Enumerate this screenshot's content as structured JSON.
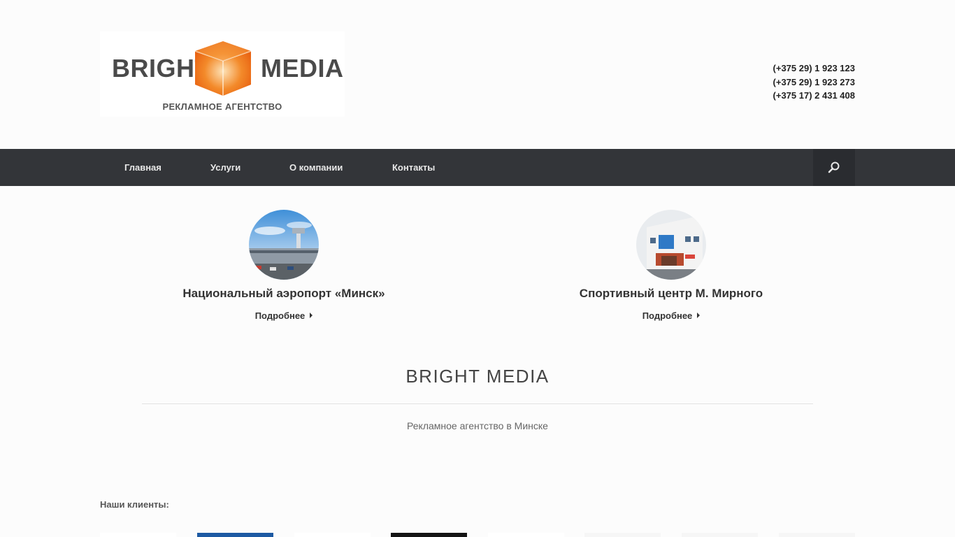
{
  "header": {
    "logo": {
      "word_left": "BRIGHT",
      "word_right": "MEDIA",
      "tagline": "РЕКЛАМНОЕ АГЕНТСТВО",
      "cube_color": "#f07a1e"
    },
    "phones": [
      "(+375 29) 1 923 123",
      "(+375 29) 1 923 273",
      "(+375 17) 2 431 408"
    ]
  },
  "nav": {
    "items": [
      {
        "label": "Главная"
      },
      {
        "label": "Услуги"
      },
      {
        "label": "О компании"
      },
      {
        "label": "Контакты"
      }
    ],
    "search_icon": "search-icon",
    "bg_color": "#333539"
  },
  "features": [
    {
      "title": "Национальный аэропорт «Минск»",
      "more": "Подробнее"
    },
    {
      "title": "Спортивный центр М. Мирного",
      "more": "Подробнее"
    }
  ],
  "section": {
    "title": "BRIGHT MEDIA",
    "subtitle": "Рекламное агентство в Минске"
  },
  "clients": {
    "label": "Наши клиенты:"
  }
}
